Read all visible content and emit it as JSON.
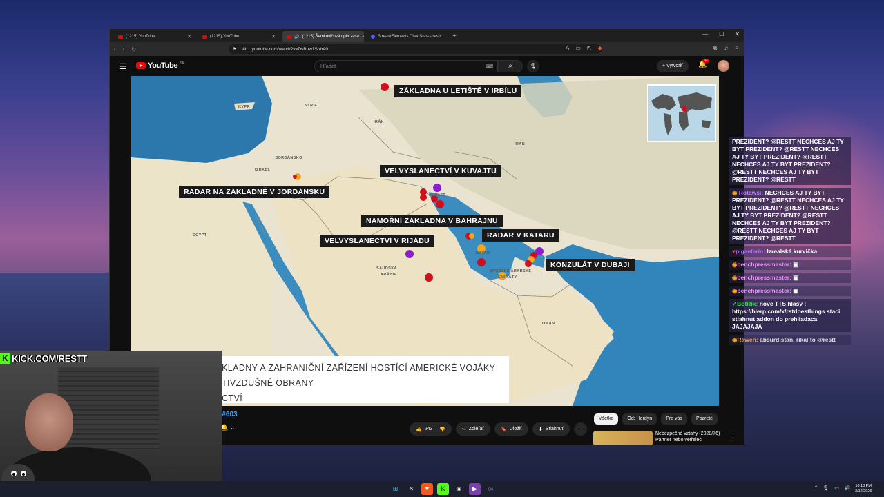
{
  "browser": {
    "tabs": [
      {
        "label": "(1215) YouTube",
        "active": false
      },
      {
        "label": "(1215) YouTube",
        "active": false
      },
      {
        "label": "(1215) Šemkovičová opět zasa",
        "active": true
      },
      {
        "label": "StreamElements Chat Stats - restt…",
        "active": false
      }
    ],
    "url": "youtube.com/watch?v=DsBuw1SubA0"
  },
  "youtube": {
    "logo": "YouTube",
    "country_code": "SK",
    "search_placeholder": "Hľadať",
    "create_label": "Vytvoriť",
    "notif_count": "9+",
    "title_fragment": "e #603",
    "like_count": "243",
    "share_label": "Zdieľať",
    "save_label": "Uložiť",
    "download_label": "Stiahnuť",
    "chips": [
      "Všetko",
      "Od: Herdyn",
      "Pre vás",
      "Pozreté"
    ],
    "rec_title": "Nebezpečné vztahy (2020/76) - Partner nebo vetřelec"
  },
  "map": {
    "labels": {
      "irbil": "ZÁKLADNA U LETIŠTĚ V IRBÍLU",
      "kuwait": "VELVYSLANECTVÍ V KUVAJTU",
      "jordan": "RADAR NA ZÁKLADNĚ V JORDÁNSKU",
      "bahrain": "NÁMOŘNÍ ZÁKLADNA V BAHRAJNU",
      "qatar": "RADAR V KATARU",
      "riyadh": "VELVYSLANECTVÍ V RIJÁDU",
      "dubai": "KONZULÁT V DUBAJI"
    },
    "geo": {
      "cyprus": "KYPR",
      "syria": "SÝRIE",
      "iraq": "IRÁK",
      "iran": "ÍRÁN",
      "israel": "IZRAEL",
      "jordan": "JORDÁNSKO",
      "egypt": "EGYPT",
      "saudi1": "SAUDSKÁ",
      "saudi2": "ARÁBIE",
      "kuwait": "KUVAJT",
      "qatar": "KATAR",
      "uae1": "SPOJENÉ ARABSKÉ",
      "uae2": "EMIRÁTY",
      "oman": "OMÁN"
    },
    "lower_third": {
      "line1": "KLADNY A ZAHRANIČNÍ ZAŘÍZENÍ HOSTÍCÍ AMERICKÉ VOJÁKY",
      "line2": "TIVZDUŠNÉ OBRANY",
      "line3": "CTVÍ"
    },
    "marker_colors": {
      "red": "#d10f1c",
      "purple": "#8a1fd0",
      "orange": "#f2a61e"
    }
  },
  "chat": {
    "messages": [
      {
        "user": "",
        "text": "PREZIDENT? @RESTT NECHCES AJ TY BYT PREZIDENT? @RESTT NECHCES AJ TY BYT PREZIDENT? @RESTT NECHCES AJ TY BYT PREZIDENT? @RESTT NECHCES AJ TY BYT PREZIDENT? @RESTT",
        "user_color": "#ffffff"
      },
      {
        "user": "Rotawsi:",
        "text": "NECHCES AJ TY BYT PREZIDENT? @RESTT NECHCES AJ TY BYT PREZIDENT? @RESTT NECHCES AJ TY BYT PREZIDENT? @RESTT NECHCES AJ TY BYT PREZIDENT? @RESTT NECHCES AJ TY BYT PREZIDENT? @RESTT",
        "user_color": "#c57bff"
      },
      {
        "user": "pigaelerin:",
        "text": "Izrealská kurvička",
        "user_color": "#b46cff"
      },
      {
        "user": "benchpressmaster:",
        "text": "",
        "user_color": "#f08cff"
      },
      {
        "user": "benchpressmaster:",
        "text": "",
        "user_color": "#f08cff"
      },
      {
        "user": "benchpressmaster:",
        "text": "",
        "user_color": "#f08cff"
      },
      {
        "user": "BotRix:",
        "text": "nove TTS hlasy : https://blerp.com/x/rstdoesthings staci stiahnut addon do prehliadaca JAJAJAJA",
        "user_color": "#2bdc55"
      },
      {
        "user": "Rawen:",
        "text": "absurdistán, říkal to @restt",
        "user_color": "#d8a46a"
      }
    ]
  },
  "overlay": {
    "kick_text": "KICK.COM/RESTT"
  },
  "taskbar": {
    "time": "10:13 PM",
    "date": "3/12/2026"
  }
}
